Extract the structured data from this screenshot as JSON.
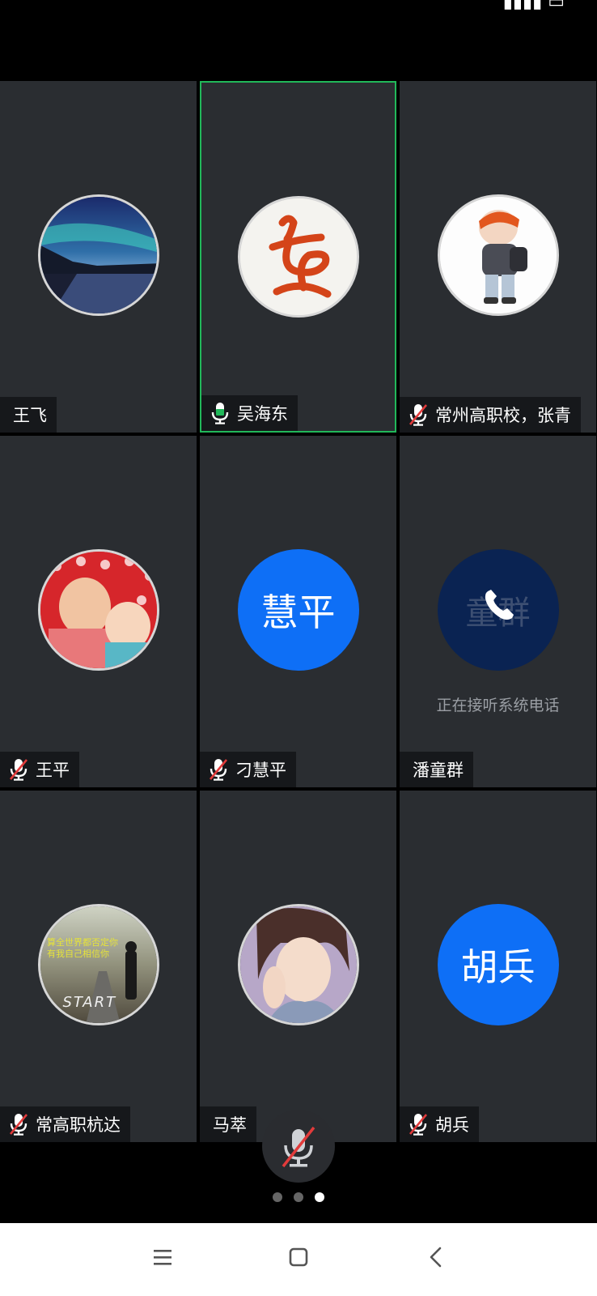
{
  "status_bar": {
    "time": "",
    "icons": [
      "location-icon",
      "alarm-icon",
      "wifi-icon",
      "signal-icon",
      "battery-icon"
    ]
  },
  "participants": [
    {
      "name": "王飞",
      "mic": "none",
      "avatar": "aurora-photo",
      "active": false
    },
    {
      "name": "吴海东",
      "mic": "on",
      "avatar": "calligraphy-dong",
      "active": true
    },
    {
      "name": "常州高职校，张青",
      "mic": "muted",
      "avatar": "cartoon-child",
      "active": false
    },
    {
      "name": "王平",
      "mic": "muted",
      "avatar": "children-photo",
      "active": false
    },
    {
      "name": "刁慧平",
      "mic": "muted",
      "avatar_initials": "慧平",
      "active": false
    },
    {
      "name": "潘童群",
      "mic": "none",
      "avatar_initials": "童群",
      "status": "正在接听系统电话",
      "active": false
    },
    {
      "name": "常高职杭达",
      "mic": "muted",
      "avatar": "man-road-start",
      "avatar_text": "START",
      "active": false
    },
    {
      "name": "马萃",
      "mic": "none",
      "avatar": "anime-boy",
      "active": false
    },
    {
      "name": "胡兵",
      "mic": "muted",
      "avatar_initials": "胡兵",
      "active": false
    }
  ],
  "controls": {
    "mic_button": "mic-muted-icon"
  },
  "pagination": {
    "total": 3,
    "current": 3
  },
  "nav_bar": [
    "menu-icon",
    "home-icon",
    "back-icon"
  ],
  "colors": {
    "tile_bg": "#2a2d31",
    "active_border": "#21b85a",
    "initials_bg": "#0e6ff6",
    "oncall_bg": "#0a2352",
    "muted_red": "#e23b3b"
  }
}
